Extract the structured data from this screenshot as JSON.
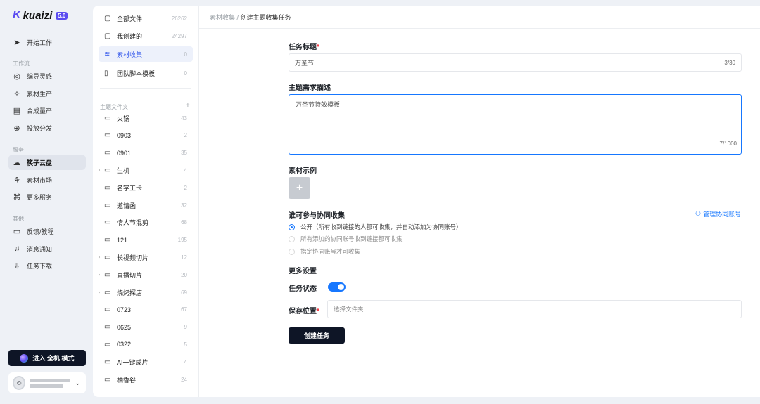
{
  "brand": {
    "name": "kuaizi",
    "version": "5.0"
  },
  "nav": {
    "start": "开始工作",
    "workflow_title": "工作流",
    "workflow": [
      "编导灵感",
      "素材生产",
      "合成量产",
      "投放分发"
    ],
    "service_title": "服务",
    "service": [
      "筷子云盘",
      "素材市场",
      "更多服务"
    ],
    "other_title": "其他",
    "other": [
      "反馈/教程",
      "消息通知",
      "任务下载"
    ],
    "enter_mode": "进入 全机 模式"
  },
  "files": {
    "top": [
      {
        "label": "全部文件",
        "count": "26262"
      },
      {
        "label": "我创建的",
        "count": "24297"
      },
      {
        "label": "素材收集",
        "count": "0"
      },
      {
        "label": "团队脚本模板",
        "count": "0"
      }
    ],
    "folder_title": "主题文件夹",
    "add": "+",
    "folders": [
      {
        "label": "火锅",
        "count": "43"
      },
      {
        "label": "0903",
        "count": "2"
      },
      {
        "label": "0901",
        "count": "35"
      },
      {
        "label": "生机",
        "count": "4"
      },
      {
        "label": "名字工卡",
        "count": "2"
      },
      {
        "label": "邀请函",
        "count": "32"
      },
      {
        "label": "情人节混剪",
        "count": "68"
      },
      {
        "label": "121",
        "count": "195"
      },
      {
        "label": "长视频切片",
        "count": "12"
      },
      {
        "label": "直播切片",
        "count": "20"
      },
      {
        "label": "烧烤探店",
        "count": "69"
      },
      {
        "label": "0723",
        "count": "67"
      },
      {
        "label": "0625",
        "count": "9"
      },
      {
        "label": "0322",
        "count": "5"
      },
      {
        "label": "AI一键成片",
        "count": "4"
      },
      {
        "label": "柚香谷",
        "count": "24"
      }
    ]
  },
  "breadcrumb": {
    "parent": "素材收集",
    "sep": " / ",
    "current": "创建主题收集任务"
  },
  "form": {
    "title_label": "任务标题",
    "title_value": "万圣节",
    "title_count": "3/30",
    "desc_label": "主题需求描述",
    "desc_value": "万圣节特效模板",
    "desc_count": "7/1000",
    "example_label": "素材示例",
    "upload_plus": "+",
    "who_label": "谁可参与协同收集",
    "manage_link": "管理协同账号",
    "options": [
      "公开（所有收到链接的人都可收集，并自动添加为协同账号）",
      "所有添加的协同账号收到链接都可收集",
      "指定协同账号才可收集"
    ],
    "more_label": "更多设置",
    "status_label": "任务状态",
    "status_on": true,
    "save_label": "保存位置",
    "save_placeholder": "选择文件夹",
    "submit": "创建任务"
  }
}
